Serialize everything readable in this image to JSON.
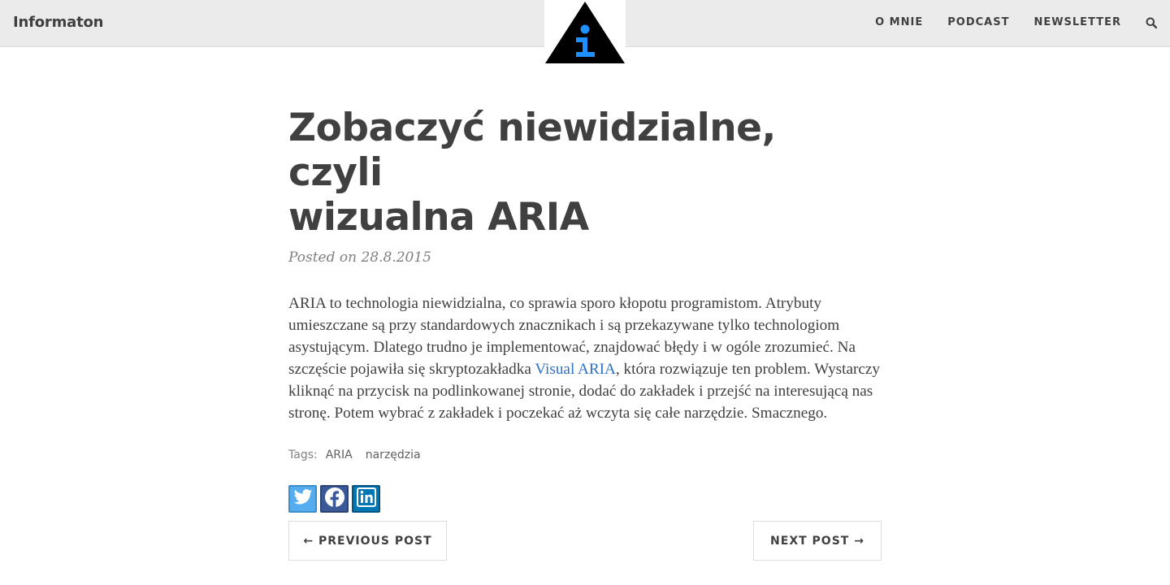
{
  "site": {
    "brand": "Informaton"
  },
  "nav": {
    "links": [
      "O MNIE",
      "PODCAST",
      "NEWSLETTER"
    ],
    "search_icon": "search-icon"
  },
  "logo": {
    "icon": "info-triangle-logo",
    "colors": {
      "triangle": "#000000",
      "glyph": "#1e90ff"
    }
  },
  "post": {
    "title_line1": "Zobaczyć niewidzialne, czyli",
    "title_line2": "wizualna ARIA",
    "meta": "Posted on 28.8.2015",
    "body_before_link": "ARIA to technologia niewidzialna, co sprawia sporo kłopotu programistom. Atrybuty umieszczane są przy standardowych znacznikach i są przekazywane tylko technologiom asystującym. Dlatego trudno je implementować, znajdować błędy i w ogóle zrozumieć. Na szczęście pojawiła się skryptozakładka ",
    "link_text": "Visual ARIA",
    "body_after_link": ", która rozwiązuje ten problem. Wystarczy kliknąć na przycisk na podlinkowanej stronie, dodać do zakładek i przejść na interesującą nas stronę. Potem wybrać z zakładek i poczekać aż wczyta się całe narzędzie. Smacznego.",
    "link_color": "#2d6fc2"
  },
  "tags": {
    "label": "Tags:",
    "items": [
      "ARIA",
      "narzędzia"
    ]
  },
  "share": {
    "buttons": [
      {
        "icon": "twitter-icon",
        "color": "#55acee"
      },
      {
        "icon": "facebook-icon",
        "color": "#3b5998"
      },
      {
        "icon": "linkedin-icon",
        "color": "#0077b5"
      }
    ]
  },
  "pager": {
    "prev": "← PREVIOUS POST",
    "next": "NEXT POST →"
  }
}
